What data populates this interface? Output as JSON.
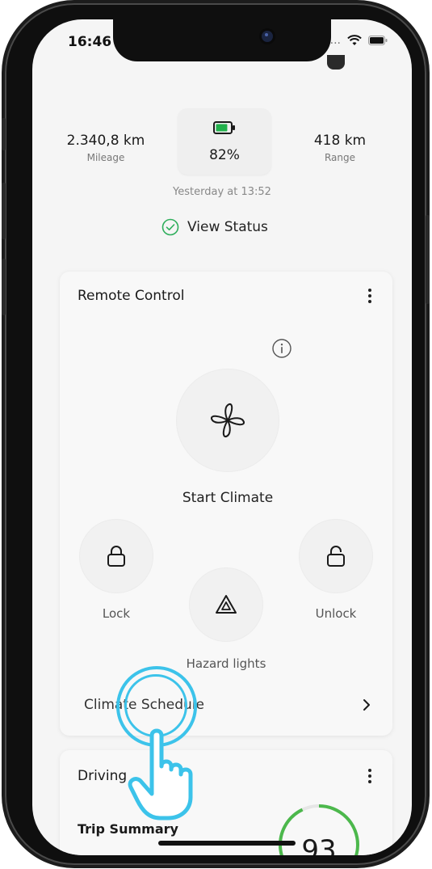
{
  "status_bar": {
    "time": "16:46",
    "carrier_dots": "..."
  },
  "vehicle": {
    "mileage_value": "2.340,8 km",
    "mileage_label": "Mileage",
    "battery_percent": "82%",
    "battery_level": 0.82,
    "range_value": "418 km",
    "range_label": "Range",
    "updated": "Yesterday at 13:52",
    "view_status": "View Status"
  },
  "remote_control": {
    "title": "Remote Control",
    "start_climate": "Start Climate",
    "lock": "Lock",
    "unlock": "Unlock",
    "hazard_lights": "Hazard lights",
    "climate_schedule": "Climate Schedule"
  },
  "driving": {
    "title": "Driving",
    "trip_summary": "Trip Summary",
    "score": "93"
  },
  "colors": {
    "battery_green": "#22b14c",
    "check_green": "#2eae5b",
    "tap_hint": "#3cc3ea",
    "score_ring": "#4cb84c"
  },
  "icons": {
    "info": "info-icon",
    "fan": "fan-icon",
    "lock": "lock-icon",
    "unlock": "unlock-icon",
    "hazard": "hazard-icon",
    "chevron": "chevron-right-icon",
    "kebab": "more-vertical-icon",
    "check": "check-circle-icon",
    "battery": "battery-icon",
    "hand": "tap-hand-icon"
  }
}
